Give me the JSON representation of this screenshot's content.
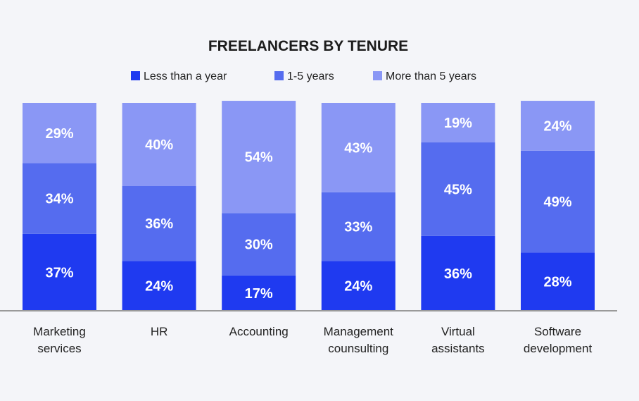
{
  "chart_data": {
    "type": "bar",
    "stacked": true,
    "title": "FREELANCERS BY TENURE",
    "xlabel": "",
    "ylabel": "",
    "ylim": [
      0,
      100
    ],
    "grid": false,
    "legend_position": "top",
    "categories": [
      [
        "Marketing",
        "services"
      ],
      [
        "HR"
      ],
      [
        "Accounting"
      ],
      [
        "Management",
        "counsulting"
      ],
      [
        "Virtual",
        "assistants"
      ],
      [
        "Software",
        "development"
      ]
    ],
    "series": [
      {
        "name": "Less than a year",
        "color": "#1f3af0",
        "values": [
          37,
          24,
          17,
          24,
          36,
          28
        ]
      },
      {
        "name": "1-5 years",
        "color": "#556cef",
        "values": [
          34,
          36,
          30,
          33,
          45,
          49
        ]
      },
      {
        "name": "More than 5 years",
        "color": "#8a97f5",
        "values": [
          29,
          40,
          54,
          43,
          19,
          24
        ]
      }
    ],
    "value_suffix": "%"
  }
}
